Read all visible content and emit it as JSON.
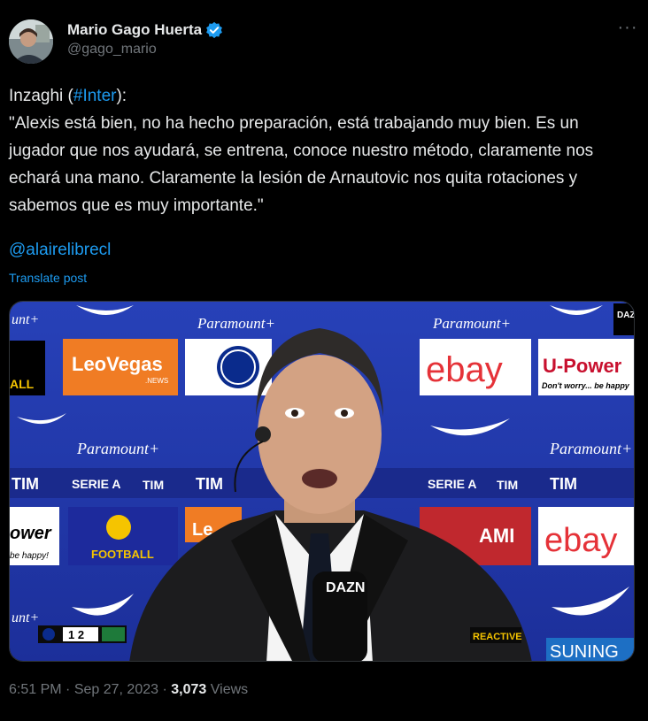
{
  "author": {
    "name": "Mario Gago Huerta",
    "handle": "@gago_mario",
    "verified": true,
    "verified_color": "#1d9bf0"
  },
  "post": {
    "lead": "Inzaghi (",
    "hashtag": "#Inter",
    "lead_end": "):",
    "quote": "\"Alexis está bien, no ha hecho preparación, está trabajando muy bien. Es un jugador que nos ayudará, se entrena, conoce nuestro método, claramente nos echará una mano. Claramente la lesión de Arnautovic nos quita rotaciones y sabemos que es muy importante.\"",
    "mention": "@alairelibrecl",
    "translate": "Translate post"
  },
  "media": {
    "backdrop_sponsors": {
      "paramount": "Paramount+",
      "leovegas": "LeoVegas",
      "leovegas_sub": ".NEWS",
      "ebay": "ebay",
      "upower": "U-Power",
      "upower_tag": "Don't worry... be happy",
      "tim": "TIM",
      "serie": "SERIE A",
      "efootball": "FOOTBALL",
      "suning": "SUNING",
      "dazn": "DAZN",
      "partial_left_top": "unt+",
      "partial_all": "ALL",
      "partial_ower": "ower",
      "partial_happy": "be happy!",
      "partial_ami": "AMI",
      "partial_le": "Le"
    },
    "mic_label": "DAZN",
    "scorebug": "1 2",
    "jacket_badge": "REACTIVE"
  },
  "meta": {
    "time": "6:51 PM",
    "separator": "·",
    "date": "Sep 27, 2023",
    "views_count": "3,073",
    "views_label": "Views"
  }
}
